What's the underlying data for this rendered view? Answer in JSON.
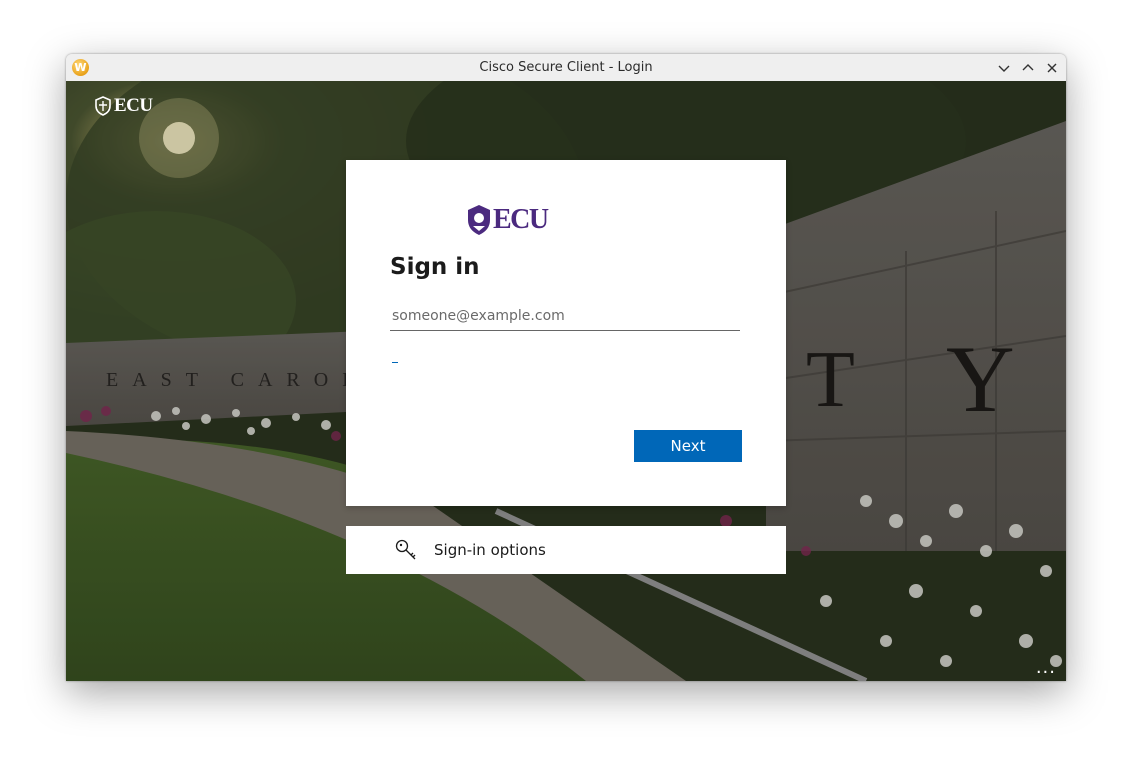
{
  "window": {
    "title": "Cisco Secure Client - Login",
    "app_icon_letter": "W"
  },
  "background": {
    "sign_text_left": "EAST CAROLIN",
    "sign_text_right": "TY"
  },
  "brand": {
    "top_logo_text": "ECU",
    "card_logo_text": "ECU",
    "purple": "#4b2a7f"
  },
  "signin": {
    "title": "Sign in",
    "email_placeholder": "someone@example.com",
    "email_value": "",
    "next_label": "Next",
    "accent": "#0067b8"
  },
  "options": {
    "label": "Sign-in options",
    "icon": "key-icon"
  },
  "footer": {
    "more_label": "..."
  }
}
